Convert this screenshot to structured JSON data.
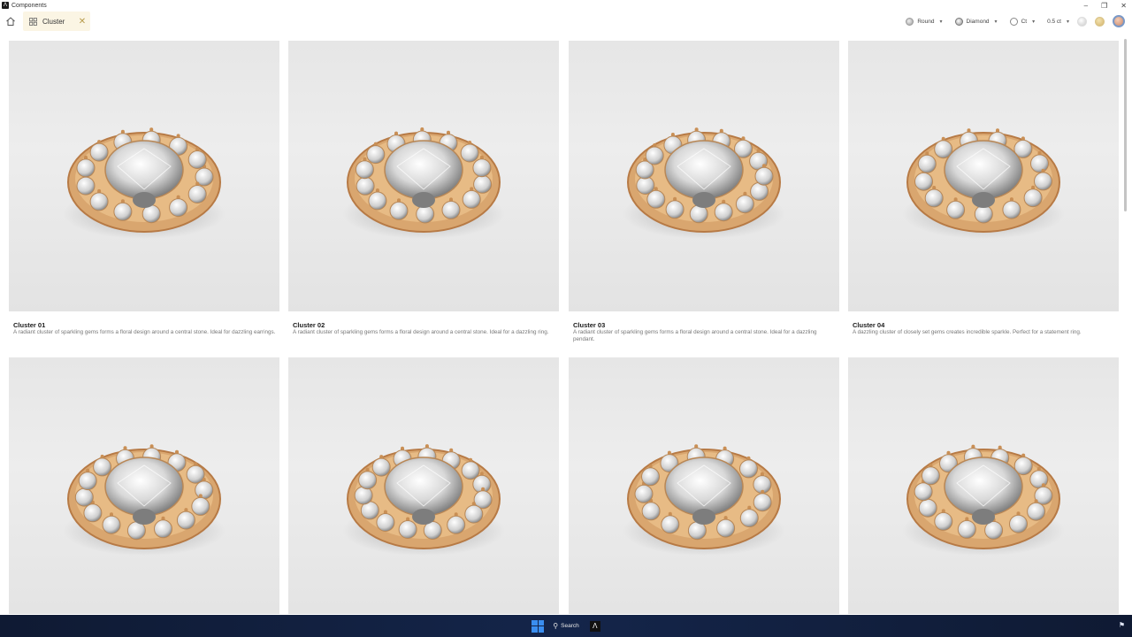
{
  "window": {
    "title": "Components",
    "app_logo_letter": "Λ"
  },
  "tab": {
    "label": "Cluster"
  },
  "filters": {
    "shape": {
      "label": "Round",
      "icon": "round-gem-icon"
    },
    "stone": {
      "label": "Diamond",
      "icon": "diamond-icon"
    },
    "unit": {
      "label": "Ct",
      "icon": "carat-icon"
    },
    "weight": {
      "label": "0.5 ct"
    },
    "metals": [
      {
        "name": "silver",
        "color": "#cfcfcf"
      },
      {
        "name": "gold",
        "color": "#d4b26b"
      },
      {
        "name": "rose-gold",
        "color": "#c9866a",
        "selected": true
      }
    ]
  },
  "cards": [
    {
      "name": "Cluster 01",
      "description": "A radiant cluster of sparkling gems forms a floral design around a central stone. Ideal for dazzling earrings."
    },
    {
      "name": "Cluster 02",
      "description": "A radiant cluster of sparkling gems forms a floral design around a central stone. Ideal for a dazzling ring."
    },
    {
      "name": "Cluster 03",
      "description": "A radiant cluster of sparkling gems forms a floral design around a central stone. Ideal for a dazzling pendant."
    },
    {
      "name": "Cluster 04",
      "description": "A dazzling cluster of closely set gems creates incredible sparkle. Perfect for a statement ring."
    },
    {
      "name": "",
      "description": ""
    },
    {
      "name": "",
      "description": ""
    },
    {
      "name": "",
      "description": ""
    },
    {
      "name": "",
      "description": ""
    }
  ],
  "taskbar": {
    "search_label": "Search",
    "app_letter": "Λ"
  }
}
